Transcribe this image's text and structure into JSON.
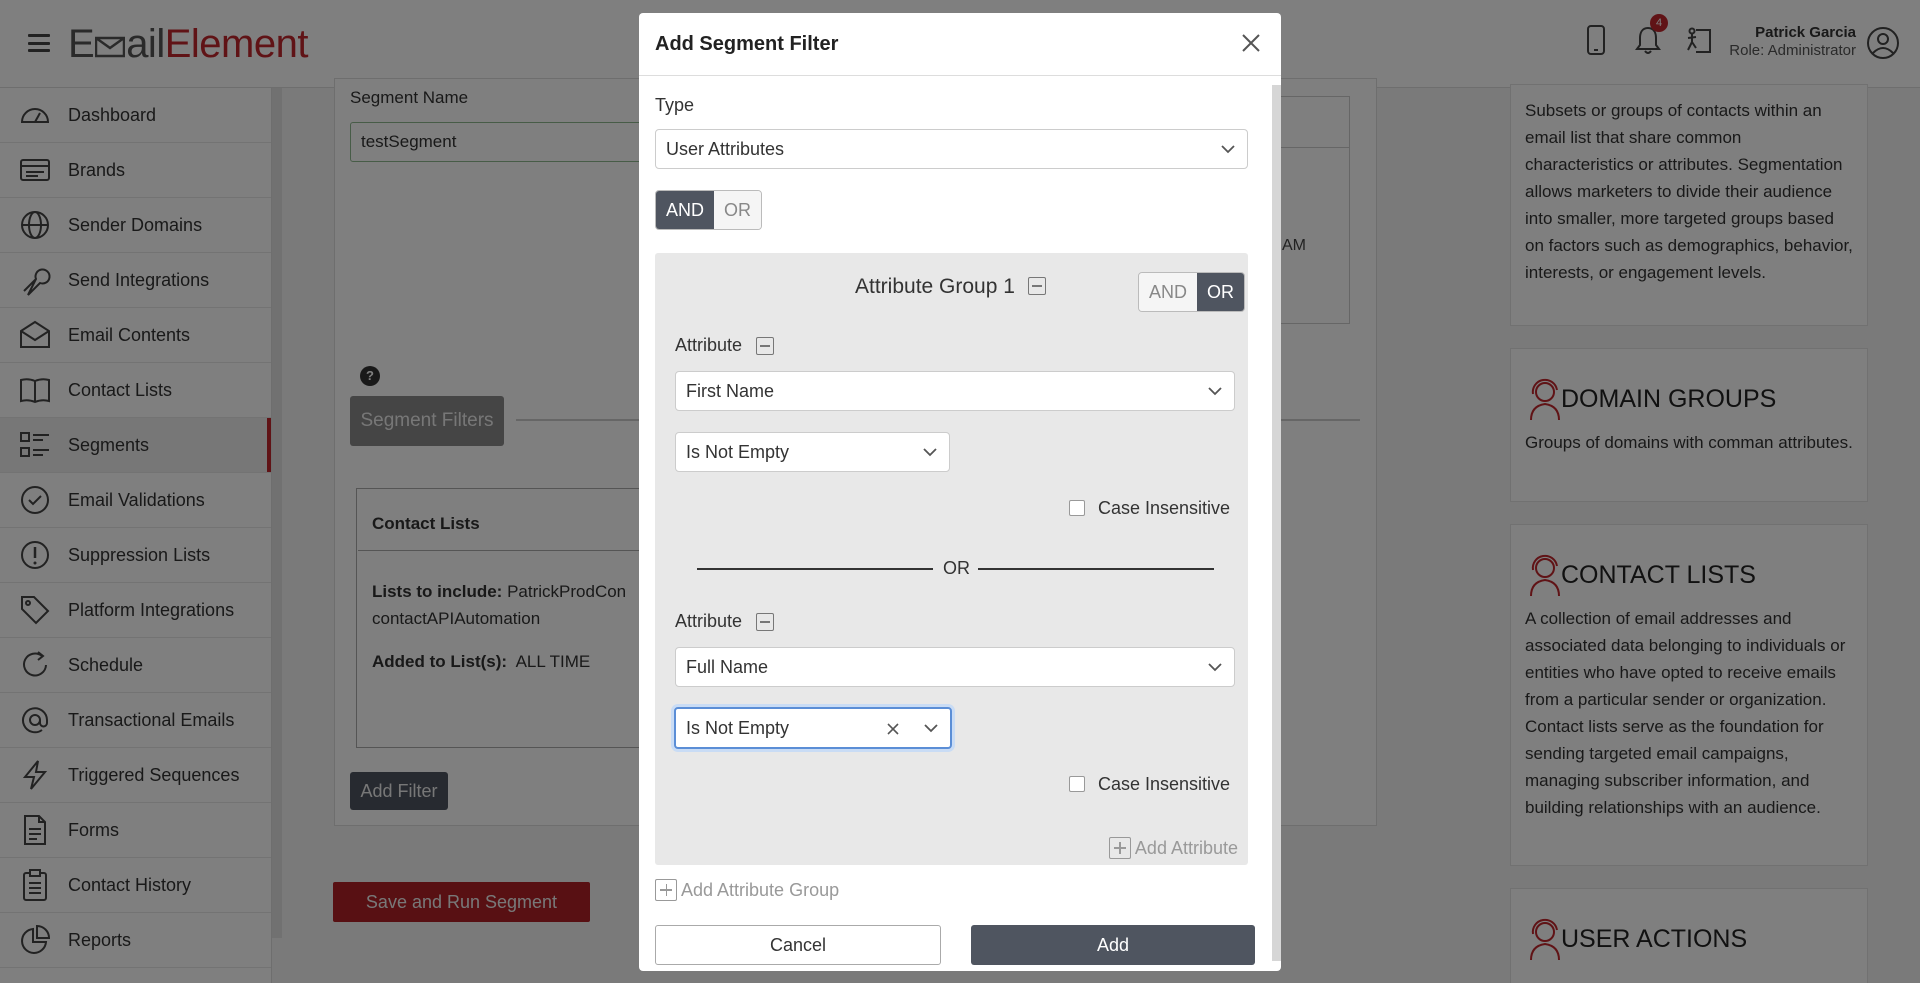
{
  "header": {
    "logo_prefix": "E",
    "logo_mid": "ail",
    "logo_suffix": "Element",
    "notification_count": "4",
    "user_name": "Patrick Garcia",
    "user_role": "Role: Administrator"
  },
  "sidebar": {
    "items": [
      {
        "label": "Dashboard",
        "icon": "dashboard-icon"
      },
      {
        "label": "Brands",
        "icon": "brands-icon"
      },
      {
        "label": "Sender Domains",
        "icon": "globe-icon"
      },
      {
        "label": "Send Integrations",
        "icon": "wrench-icon"
      },
      {
        "label": "Email Contents",
        "icon": "envelope-icon"
      },
      {
        "label": "Contact Lists",
        "icon": "book-icon"
      },
      {
        "label": "Segments",
        "icon": "segments-icon",
        "active": true
      },
      {
        "label": "Email Validations",
        "icon": "check-circle-icon"
      },
      {
        "label": "Suppression Lists",
        "icon": "exclamation-circle-icon"
      },
      {
        "label": "Platform Integrations",
        "icon": "tag-icon"
      },
      {
        "label": "Schedule",
        "icon": "clock-refresh-icon"
      },
      {
        "label": "Transactional Emails",
        "icon": "at-icon"
      },
      {
        "label": "Triggered Sequences",
        "icon": "lightning-icon"
      },
      {
        "label": "Forms",
        "icon": "document-icon"
      },
      {
        "label": "Contact History",
        "icon": "clipboard-icon"
      },
      {
        "label": "Reports",
        "icon": "pie-chart-icon"
      }
    ]
  },
  "main": {
    "segment_name_label": "Segment Name",
    "segment_name_value": "testSegment",
    "time_suffix": "AM",
    "help_icon": "?",
    "segment_filters_button": "Segment Filters",
    "contact_lists_heading": "Contact Lists",
    "lists_to_include_label": "Lists to include:",
    "lists_to_include_value": "PatrickProdCon",
    "lists_to_include_value_2": "contactAPIAutomation",
    "added_to_lists_label": "Added to List(s):",
    "added_to_lists_value": "ALL TIME",
    "add_filter_button": "Add Filter",
    "save_run_button": "Save and Run Segment"
  },
  "info_panel": {
    "segments_body": "Subsets or groups of contacts within an email list that share common characteristics or attributes. Segmentation allows marketers to divide their audience into smaller, more targeted groups based on factors such as demographics, behavior, interests, or engagement levels.",
    "domain_groups_title": "DOMAIN GROUPS",
    "domain_groups_body": "Groups of domains with comman attributes.",
    "contact_lists_title": "CONTACT LISTS",
    "contact_lists_body": "A collection of email addresses and associated data belonging to individuals or entities who have opted to receive emails from a particular sender or organization. Contact lists serve as the foundation for sending targeted email campaigns, managing subscriber information, and building relationships with an audience.",
    "user_actions_title": "USER ACTIONS"
  },
  "modal": {
    "title": "Add Segment Filter",
    "type_label": "Type",
    "type_value": "User Attributes",
    "outer_and": "AND",
    "outer_or": "OR",
    "group_title": "Attribute Group 1",
    "group_and": "AND",
    "group_or": "OR",
    "attribute_label": "Attribute",
    "attr1_field": "First Name",
    "attr1_condition": "Is Not Empty",
    "case_insensitive": "Case Insensitive",
    "or_divider": "OR",
    "attr2_field": "Full Name",
    "attr2_condition": "Is Not Empty",
    "add_attribute": "Add Attribute",
    "add_attribute_group": "Add Attribute Group",
    "cancel": "Cancel",
    "add": "Add"
  },
  "colors": {
    "brand_red": "#c0272d",
    "dark_button": "#4f5560",
    "focus_blue": "#5b8ed6"
  }
}
